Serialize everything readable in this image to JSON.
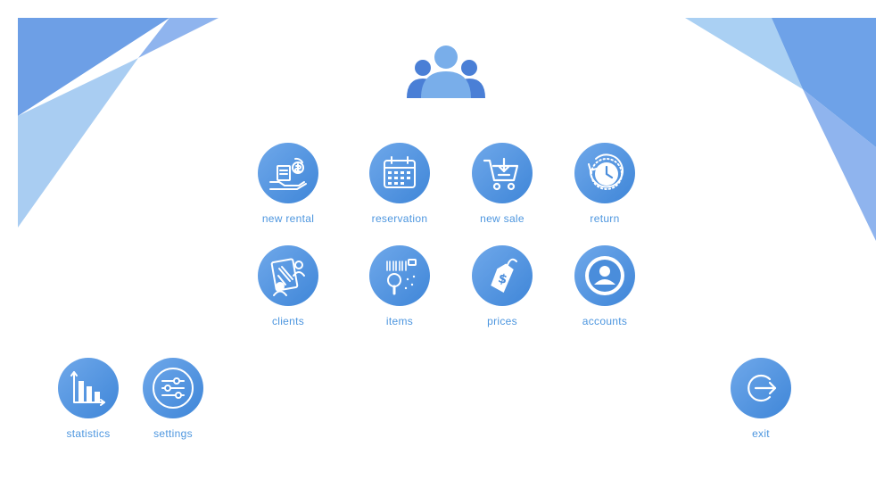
{
  "colors": {
    "accent": "#4a90e2",
    "label": "#4d96df",
    "corner_dark": "#6b9de8",
    "corner_light": "#a6ccf1"
  },
  "header": {
    "logo_icon": "users-group-icon"
  },
  "menu": {
    "items": [
      {
        "label": "new rental",
        "icon": "rental-handout-icon"
      },
      {
        "label": "reservation",
        "icon": "calendar-icon"
      },
      {
        "label": "new sale",
        "icon": "shopping-cart-icon"
      },
      {
        "label": "return",
        "icon": "clock-return-icon"
      },
      {
        "label": "clients",
        "icon": "client-document-icon"
      },
      {
        "label": "items",
        "icon": "barcode-scan-icon"
      },
      {
        "label": "prices",
        "icon": "price-tag-icon"
      },
      {
        "label": "accounts",
        "icon": "user-account-icon"
      }
    ]
  },
  "footer": {
    "statistics": {
      "label": "statistics",
      "icon": "bar-chart-icon"
    },
    "settings": {
      "label": "settings",
      "icon": "sliders-icon"
    },
    "exit": {
      "label": "exit",
      "icon": "exit-icon"
    }
  }
}
